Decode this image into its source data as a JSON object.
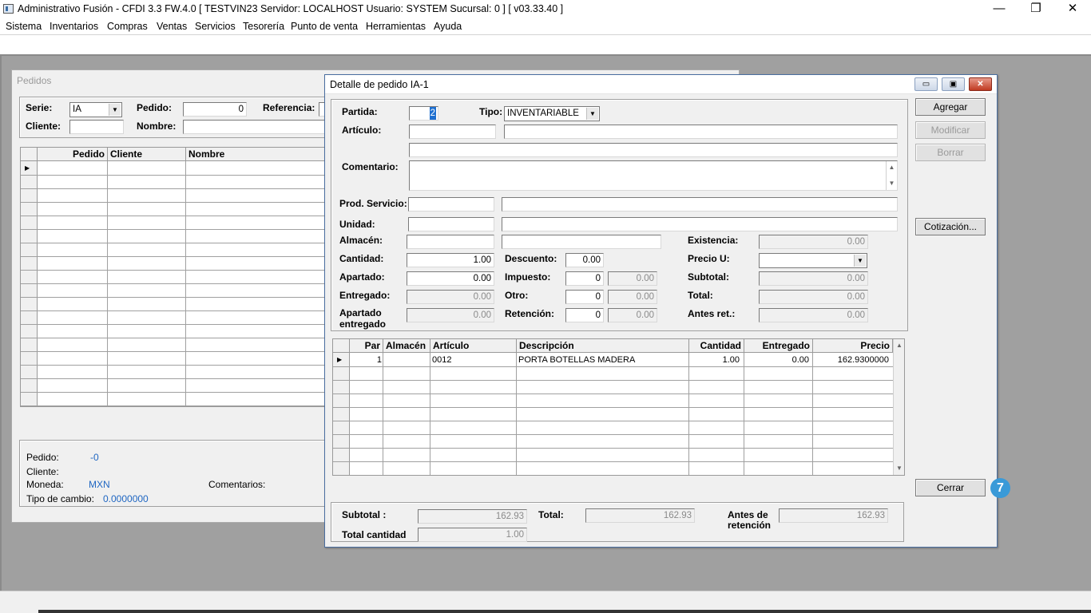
{
  "app": {
    "title": "Administrativo Fusión - CFDI 3.3 FW.4.0 [ TESTVIN23   Servidor: LOCALHOST   Usuario: SYSTEM    Sucursal: 0 ] [ v03.33.40 ]",
    "minimize": "—",
    "maximize": "❐",
    "close": "✕"
  },
  "menu": [
    "Sistema",
    "Inventarios",
    "Compras",
    "Ventas",
    "Servicios",
    "Tesorería",
    "Punto de venta",
    "Herramientas",
    "Ayuda"
  ],
  "pedidos": {
    "caption": "Pedidos",
    "serie_label": "Serie:",
    "serie_value": "IA",
    "pedido_label": "Pedido:",
    "pedido_value": "0",
    "referencia_label": "Referencia:",
    "cliente_label": "Cliente:",
    "nombre_label": "Nombre:",
    "grid_headers": [
      "Pedido",
      "Cliente",
      "Nombre"
    ],
    "footer": {
      "pedido_label": "Pedido:",
      "pedido_value": "-0",
      "cliente_label": "Cliente:",
      "moneda_label": "Moneda:",
      "moneda_value": "MXN",
      "comentarios_label": "Comentarios:",
      "tipo_cambio_label": "Tipo de cambio:",
      "tipo_cambio_value": "0.0000000"
    }
  },
  "dialog": {
    "title": "Detalle de pedido IA-1",
    "partida_label": "Partida:",
    "partida_value": "2",
    "tipo_label": "Tipo:",
    "tipo_value": "INVENTARIABLE",
    "articulo_label": "Artículo:",
    "comentario_label": "Comentario:",
    "prod_servicio_label": "Prod. Servicio:",
    "unidad_label": "Unidad:",
    "almacen_label": "Almacén:",
    "existencia_label": "Existencia:",
    "existencia_value": "0.00",
    "cantidad_label": "Cantidad:",
    "cantidad_value": "1.00",
    "descuento_label": "Descuento:",
    "descuento_value": "0.00",
    "precio_u_label": "Precio U:",
    "apartado_label": "Apartado:",
    "apartado_value": "0.00",
    "impuesto_label": "Impuesto:",
    "impuesto_value": "0",
    "impuesto_amount": "0.00",
    "subtotal_label": "Subtotal:",
    "subtotal_value": "0.00",
    "entregado_label": "Entregado:",
    "entregado_value": "0.00",
    "otro_label": "Otro:",
    "otro_value": "0",
    "otro_amount": "0.00",
    "total_label": "Total:",
    "total_value": "0.00",
    "apartado_entregado_label_1": "Apartado",
    "apartado_entregado_label_2": "entregado",
    "apartado_entregado_value": "0.00",
    "retencion_label": "Retención:",
    "retencion_value": "0",
    "retencion_amount": "0.00",
    "antes_ret_label": "Antes ret.:",
    "antes_ret_value": "0.00",
    "buttons": {
      "agregar": "Agregar",
      "modificar": "Modificar",
      "borrar": "Borrar",
      "cotizacion": "Cotización...",
      "cerrar": "Cerrar"
    },
    "grid_headers": [
      "Par",
      "Almacén",
      "Artículo",
      "Descripción",
      "Cantidad",
      "Entregado",
      "Precio"
    ],
    "rows": [
      {
        "par": "1",
        "almacen": "",
        "articulo": "0012",
        "descripcion": "PORTA BOTELLAS MADERA",
        "cantidad": "1.00",
        "entregado": "0.00",
        "precio": "162.9300000"
      }
    ],
    "summary": {
      "subtotal_label": "Subtotal :",
      "subtotal_value": "162.93",
      "total_label": "Total:",
      "total_value": "162.93",
      "antes_label_1": "Antes de",
      "antes_label_2": "retención",
      "antes_value": "162.93",
      "total_cantidad_label": "Total cantidad",
      "total_cantidad_value": "1.00"
    }
  },
  "badge": "7"
}
